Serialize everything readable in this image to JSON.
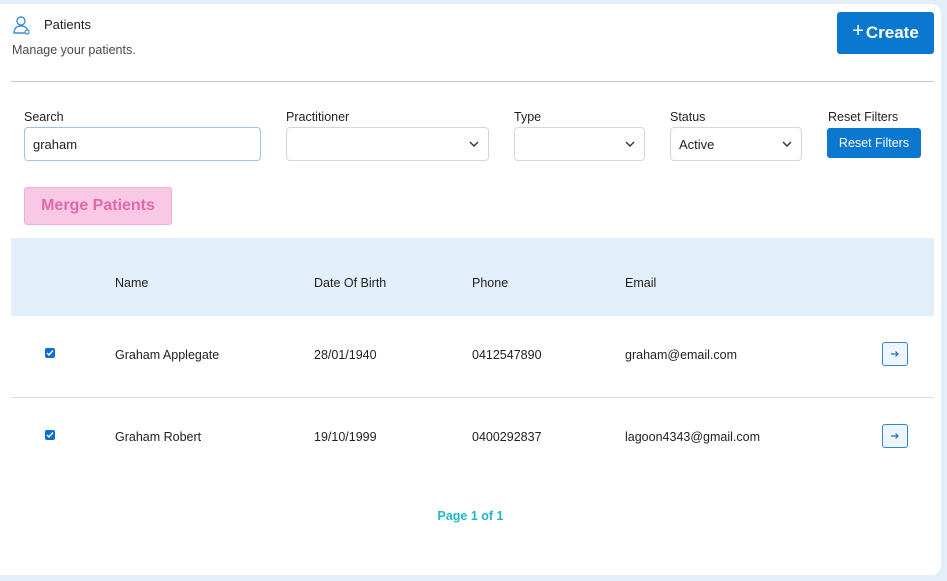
{
  "header": {
    "icon": "user-icon",
    "title": "Patients",
    "subtitle": "Manage your patients.",
    "create_label": "Create",
    "create_icon": "plus-icon"
  },
  "filters": {
    "search": {
      "label": "Search",
      "value": "graham"
    },
    "practitioner": {
      "label": "Practitioner",
      "value": ""
    },
    "type": {
      "label": "Type",
      "value": ""
    },
    "status": {
      "label": "Status",
      "value": "Active"
    },
    "reset": {
      "label": "Reset Filters",
      "button_label": "Reset Filters"
    }
  },
  "merge_label": "Merge Patients",
  "table": {
    "columns": [
      "Name",
      "Date Of Birth",
      "Phone",
      "Email"
    ],
    "rows": [
      {
        "checked": true,
        "name": "Graham Applegate",
        "dob": "28/01/1940",
        "phone": "0412547890",
        "email": "graham@email.com"
      },
      {
        "checked": true,
        "name": "Graham Robert",
        "dob": "19/10/1999",
        "phone": "0400292837",
        "email": "lagoon4343@gmail.com"
      }
    ]
  },
  "pagination": {
    "text": "Page 1 of 1"
  },
  "colors": {
    "primary": "#0b78d0",
    "merge_bg": "#f8c8e4",
    "merge_text": "#e06aa8",
    "table_header_bg": "#e2eef9",
    "pager_text": "#1fb8c8"
  }
}
